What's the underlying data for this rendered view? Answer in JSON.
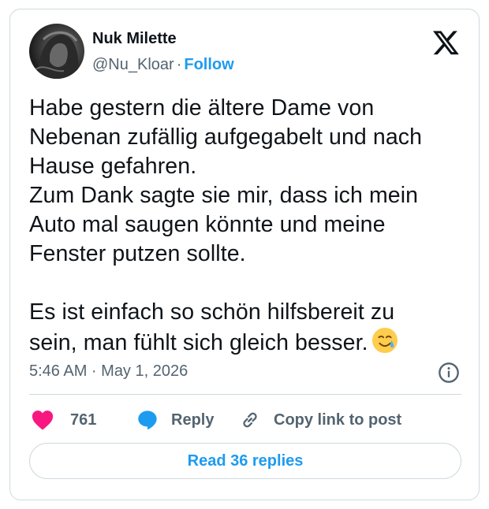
{
  "author": {
    "name": "Nuk Milette",
    "handle": "@Nu_Kloar",
    "separator": "·",
    "follow_label": "Follow"
  },
  "post": {
    "lines": [
      "Habe gestern die ältere Dame von",
      "Nebenan zufällig aufgegabelt und nach",
      "Hause gefahren.",
      "Zum Dank sagte sie mir, dass ich mein",
      "Auto mal saugen könnte und meine",
      "Fenster putzen sollte.",
      "",
      "Es ist einfach so schön hilfsbereit zu",
      "sein, man fühlt sich gleich besser."
    ],
    "emoji": "smiling-face-with-tear",
    "timestamp": "5:46 AM · May 1, 2026"
  },
  "actions": {
    "like_count": "761",
    "reply_label": "Reply",
    "copy_label": "Copy link to post"
  },
  "read_replies_label": "Read 36 replies",
  "icons": [
    "x-logo-icon",
    "info-icon",
    "heart-icon",
    "reply-bubble-icon",
    "link-icon",
    "smiling-face-with-tear-emoji"
  ],
  "colors": {
    "accent": "#1d9bf0",
    "heart": "#f91880",
    "text": "#0f1419",
    "secondary": "#536471",
    "border": "#cfd9de"
  }
}
